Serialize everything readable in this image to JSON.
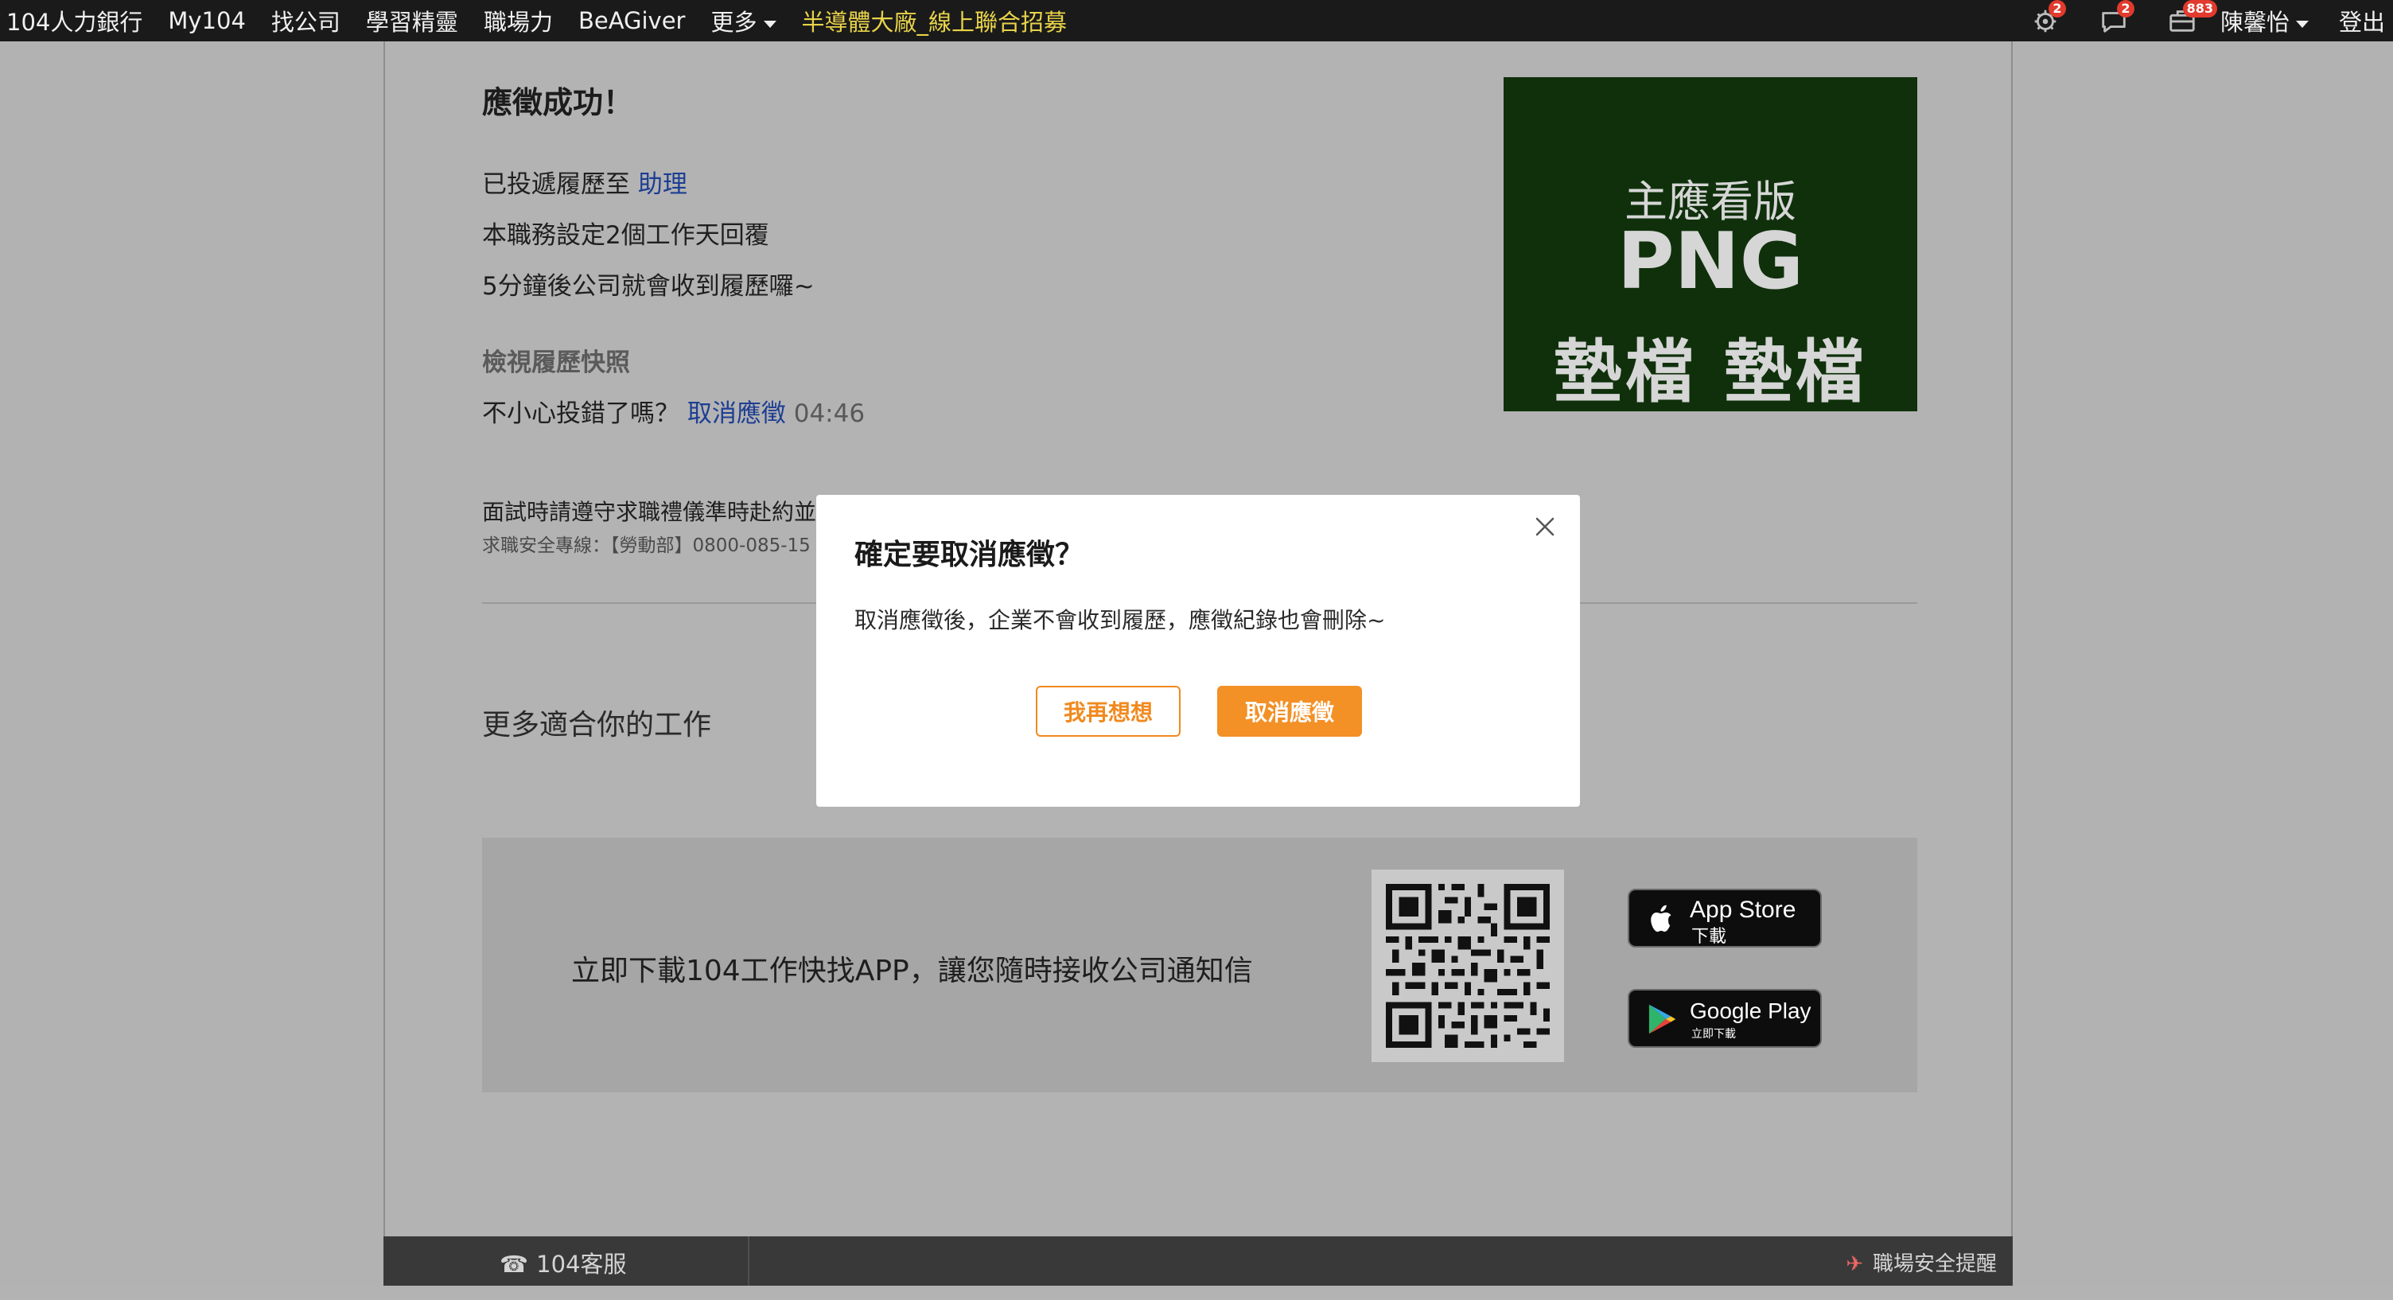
{
  "topnav": {
    "items": [
      "104人力銀行",
      "My104",
      "找公司",
      "學習精靈",
      "職場力",
      "BeAGiver"
    ],
    "more_label": "更多",
    "promo_label": "半導體大廠_線上聯合招募",
    "icons": [
      {
        "name": "notification-icon",
        "badge": "2"
      },
      {
        "name": "chat-icon",
        "badge": "2"
      },
      {
        "name": "briefcase-icon",
        "badge": "883"
      }
    ],
    "user_name": "陳馨怡",
    "logout_label": "登出"
  },
  "result": {
    "title": "應徵成功！",
    "sent_prefix": "已投遞履歷至",
    "job_name": "助理",
    "reply_line": "本職務設定2個工作天回覆",
    "receive_line": "5分鐘後公司就會收到履歷囉~",
    "snapshot_label": "檢視履歷快照",
    "wrong_prefix": "不小心投錯了嗎？",
    "cancel_link": "取消應徵",
    "countdown": "04:46",
    "notice": "面試時請遵守求職禮儀準時赴約並",
    "hotline": "求職安全專線：【勞動部】0800-085-15"
  },
  "banner": {
    "line1": "主應看版",
    "line2": "PNG",
    "line3": "墊檔 墊檔"
  },
  "more_jobs": {
    "title": "更多適合你的工作"
  },
  "app_download": {
    "text": "立即下載104工作快找APP，讓您隨時接收公司通知信",
    "app_store": {
      "big": "App Store",
      "small": "下載"
    },
    "google_play": {
      "big": "Google Play",
      "small": "立即下載"
    }
  },
  "footer": {
    "customer_service": "104客服",
    "safety_notice": "職場安全提醒"
  },
  "modal": {
    "title": "確定要取消應徵？",
    "message": "取消應徵後，企業不會收到履歷，應徵紀錄也會刪除~",
    "secondary_button": "我再想想",
    "primary_button": "取消應徵"
  },
  "colors": {
    "accent_orange": "#f39026",
    "link_blue": "#1d3e93",
    "banner_green": "#0f300b",
    "overlay_gray": "#b3b3b3",
    "nav_dark": "#1a1a1a"
  }
}
